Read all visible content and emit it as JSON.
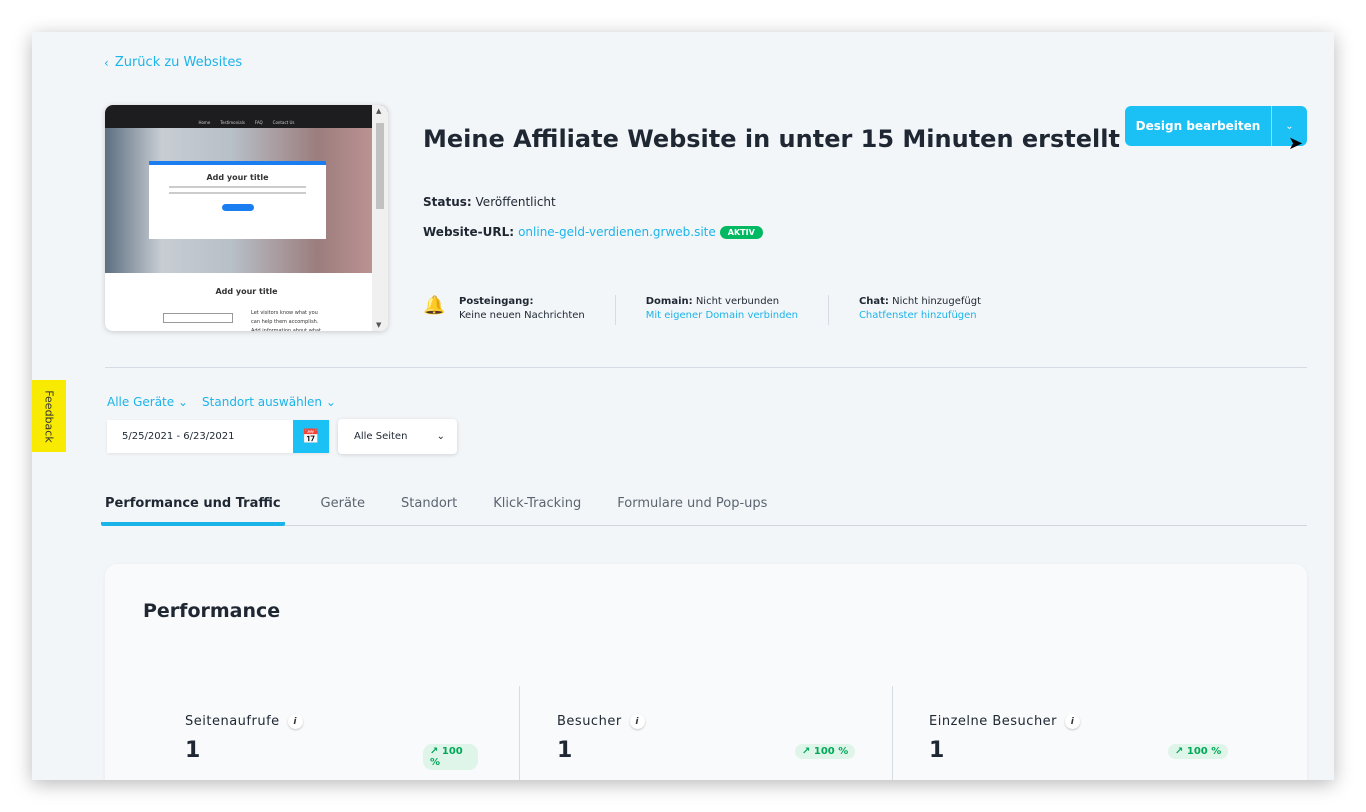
{
  "back_link": "Zurück zu Websites",
  "preview": {
    "nav_items": [
      "Home",
      "Testimonials",
      "FAQ",
      "Contact Us"
    ],
    "card_title": "Add your title",
    "section_title": "Add your title",
    "side_text": "Let visitors know what you can help them accomplish. Add information about what"
  },
  "site_title": "Meine Affiliate Website in unter 15 Minuten erstellt",
  "status": {
    "label": "Status:",
    "value": "Veröffentlicht"
  },
  "website_url": {
    "label": "Website-URL:",
    "value": "online-geld-verdienen.grweb.site",
    "badge": "AKTIV"
  },
  "design_button": "Design bearbeiten",
  "inbox": {
    "label": "Posteingang:",
    "value": "Keine neuen Nachrichten"
  },
  "domain": {
    "label": "Domain:",
    "value": "Nicht verbunden",
    "link": "Mit eigener Domain verbinden"
  },
  "chat": {
    "label": "Chat:",
    "value": "Nicht hinzugefügt",
    "link": "Chatfenster hinzufügen"
  },
  "feedback": "Feedback",
  "filters": {
    "devices": "Alle Geräte",
    "location": "Standort auswählen"
  },
  "date_range": "5/25/2021 - 6/23/2021",
  "pages_select": "Alle Seiten",
  "tabs": [
    "Performance und Traffic",
    "Geräte",
    "Standort",
    "Klick-Tracking",
    "Formulare und Pop-ups"
  ],
  "performance": {
    "heading": "Performance",
    "metrics": [
      {
        "label": "Seitenaufrufe",
        "value": "1",
        "change": "100 %"
      },
      {
        "label": "Besucher",
        "value": "1",
        "change": "100 %"
      },
      {
        "label": "Einzelne Besucher",
        "value": "1",
        "change": "100 %"
      }
    ]
  },
  "colors": {
    "accent": "#1bc0f5",
    "link": "#1bb4e8",
    "success": "#00b961",
    "feedback": "#f8ea00"
  },
  "icons": [
    "chevron-left-icon",
    "chevron-down-icon",
    "bell-icon",
    "calendar-icon",
    "info-icon",
    "arrow-up-right-icon"
  ]
}
